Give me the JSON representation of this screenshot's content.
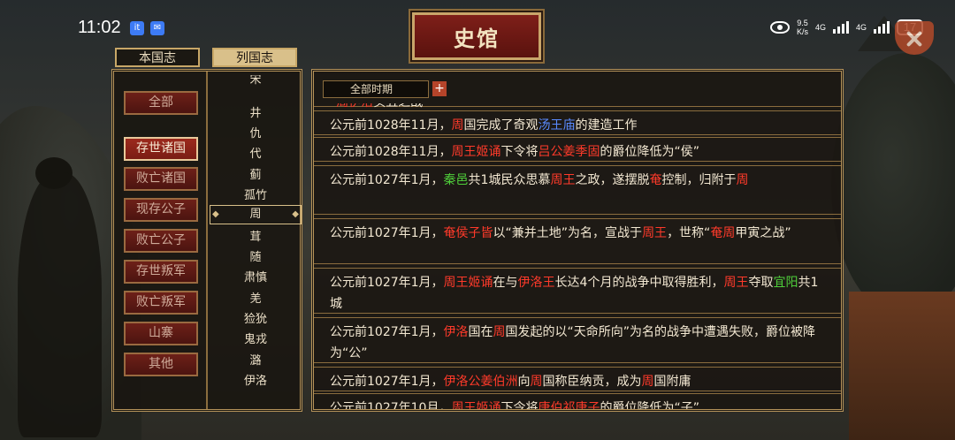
{
  "status_bar": {
    "time": "11:02",
    "app_icon_1": "it",
    "app_icon_2": "chat",
    "speed_value": "9.5",
    "speed_unit": "K/s",
    "net_1": "4G",
    "net_2": "4G",
    "battery": "17"
  },
  "title": "史馆",
  "tabs": {
    "domestic": "本国志",
    "states": "列国志"
  },
  "categories": [
    {
      "label": "全部"
    },
    {
      "label": "存世诸国"
    },
    {
      "label": "败亡诸国"
    },
    {
      "label": "现存公子"
    },
    {
      "label": "败亡公子"
    },
    {
      "label": "存世叛军"
    },
    {
      "label": "败亡叛军"
    },
    {
      "label": "山寨"
    },
    {
      "label": "其他"
    }
  ],
  "states": [
    "宋",
    "井",
    "仇",
    "代",
    "蓟",
    "孤竹",
    "周",
    "茸",
    "随",
    "肃慎",
    "羌",
    "猃狁",
    "鬼戎",
    "潞",
    "伊洛"
  ],
  "selected_state": "周",
  "period": {
    "value": "全部时期",
    "plus": "+"
  },
  "events": [
    {
      "parts": [
        {
          "t": "“"
        },
        {
          "t": "周伊洛",
          "c": "red"
        },
        {
          "t": "癸丑之战”"
        }
      ]
    },
    {
      "parts": [
        {
          "t": "公元前1028年11月，"
        },
        {
          "t": "周",
          "c": "red"
        },
        {
          "t": "国完成了奇观"
        },
        {
          "t": "汤王庙",
          "c": "blue"
        },
        {
          "t": "的建造工作"
        }
      ]
    },
    {
      "parts": [
        {
          "t": "公元前1028年11月，"
        },
        {
          "t": "周王姬诵",
          "c": "red"
        },
        {
          "t": "下令将"
        },
        {
          "t": "吕公姜季固",
          "c": "red"
        },
        {
          "t": "的爵位降低为“侯”"
        }
      ]
    },
    {
      "parts": [
        {
          "t": "公元前1027年1月，"
        },
        {
          "t": "秦邑",
          "c": "green"
        },
        {
          "t": "共1城民众思慕"
        },
        {
          "t": "周王",
          "c": "red"
        },
        {
          "t": "之政，遂摆脱"
        },
        {
          "t": "奄",
          "c": "red"
        },
        {
          "t": "控制，归附于"
        },
        {
          "t": "周",
          "c": "red"
        }
      ]
    },
    {
      "parts": [
        {
          "t": "公元前1027年1月，"
        },
        {
          "t": "奄侯子皆",
          "c": "red"
        },
        {
          "t": "以“兼并土地”为名，宣战于"
        },
        {
          "t": "周王",
          "c": "red"
        },
        {
          "t": "，世称“"
        },
        {
          "t": "奄周",
          "c": "red"
        },
        {
          "t": "甲寅之战”"
        }
      ]
    },
    {
      "parts": [
        {
          "t": "公元前1027年1月，"
        },
        {
          "t": "周王姬诵",
          "c": "red"
        },
        {
          "t": "在与"
        },
        {
          "t": "伊洛王",
          "c": "red"
        },
        {
          "t": "长达4个月的战争中取得胜利，"
        },
        {
          "t": "周王",
          "c": "red"
        },
        {
          "t": "夺取"
        },
        {
          "t": "宜阳",
          "c": "green"
        },
        {
          "t": "共1城"
        }
      ]
    },
    {
      "parts": [
        {
          "t": "公元前1027年1月，"
        },
        {
          "t": "伊洛",
          "c": "red"
        },
        {
          "t": "国在"
        },
        {
          "t": "周",
          "c": "red"
        },
        {
          "t": "国发起的以“天命所向”为名的战争中遭遇失败，爵位被降为“公”"
        }
      ]
    },
    {
      "parts": [
        {
          "t": "公元前1027年1月，"
        },
        {
          "t": "伊洛公姜伯洲",
          "c": "red"
        },
        {
          "t": "向"
        },
        {
          "t": "周",
          "c": "red"
        },
        {
          "t": "国称臣纳贡，成为"
        },
        {
          "t": "周",
          "c": "red"
        },
        {
          "t": "国附庸"
        }
      ]
    },
    {
      "parts": [
        {
          "t": "公元前1027年10月，"
        },
        {
          "t": "周王姬诵",
          "c": "red"
        },
        {
          "t": "下令将"
        },
        {
          "t": "唐伯祁唐子",
          "c": "red"
        },
        {
          "t": "的爵位降低为“子”"
        }
      ]
    }
  ]
}
